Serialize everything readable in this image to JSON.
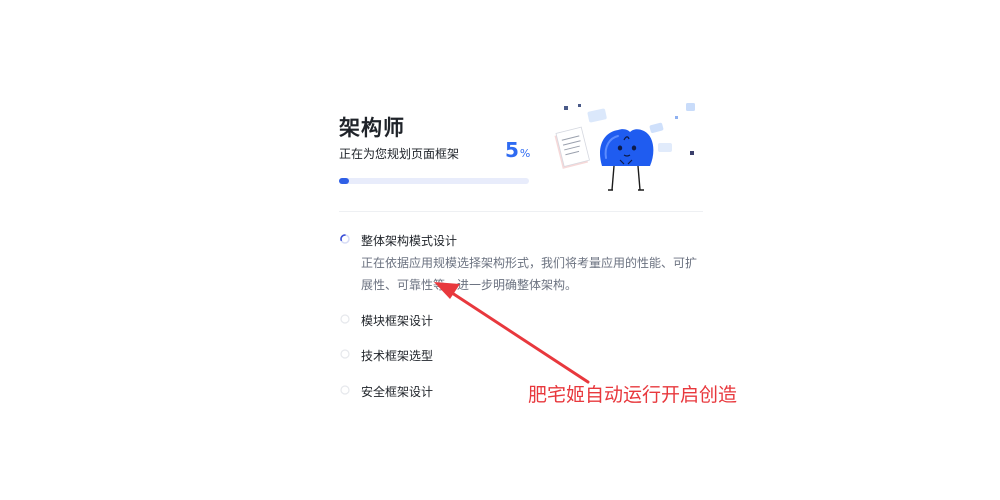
{
  "card": {
    "title": "架构师",
    "subtitle": "正在为您规划页面框架",
    "progress": {
      "value": "5",
      "unit": "%",
      "fraction": 0.05
    }
  },
  "steps": [
    {
      "label": "整体架构模式设计",
      "status": "active",
      "description": "正在依据应用规模选择架构形式，我们将考量应用的性能、可扩展性、可靠性等，进一步明确整体架构。"
    },
    {
      "label": "模块框架设计",
      "status": "pending"
    },
    {
      "label": "技术框架选型",
      "status": "pending"
    },
    {
      "label": "安全框架设计",
      "status": "pending"
    }
  ],
  "annotation": {
    "text": "肥宅姬自动运行开启创造"
  },
  "colors": {
    "accent": "#2f6bf2",
    "annotation": "#e8383d",
    "mascot": "#1f5cf0"
  },
  "illustration": {
    "icon": "mascot-character"
  }
}
